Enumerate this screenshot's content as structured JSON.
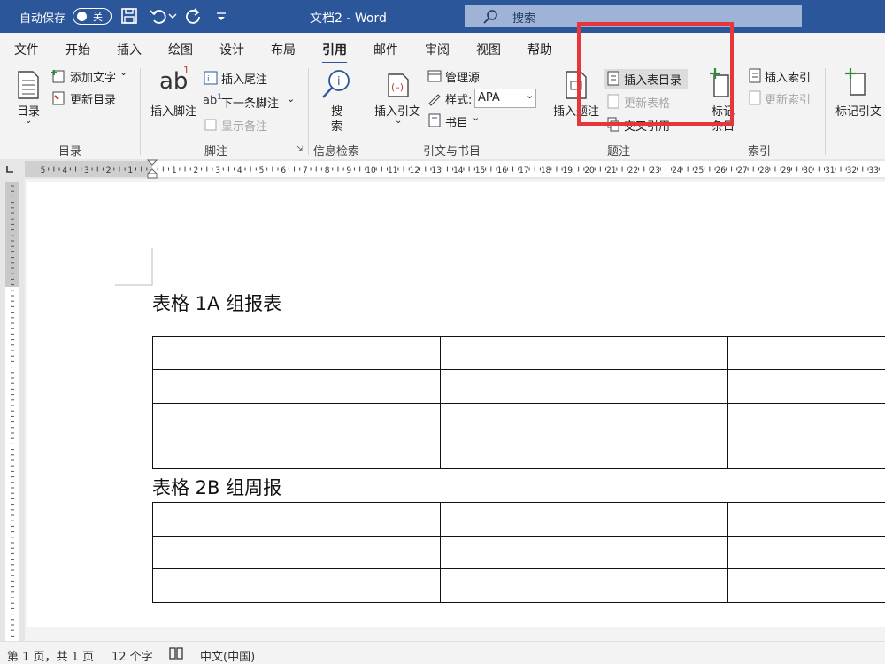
{
  "titlebar": {
    "autosave_label": "自动保存",
    "autosave_state": "关",
    "doc_title": "文档2  -  Word",
    "search_placeholder": "搜索"
  },
  "tabs": [
    {
      "label": "文件"
    },
    {
      "label": "开始"
    },
    {
      "label": "插入"
    },
    {
      "label": "绘图"
    },
    {
      "label": "设计"
    },
    {
      "label": "布局"
    },
    {
      "label": "引用",
      "active": true
    },
    {
      "label": "邮件"
    },
    {
      "label": "审阅"
    },
    {
      "label": "视图"
    },
    {
      "label": "帮助"
    }
  ],
  "ribbon": {
    "toc": {
      "button": "目录",
      "add_text": "添加文字",
      "update_toc": "更新目录",
      "group": "目录"
    },
    "footnotes": {
      "insert_footnote": "插入脚注",
      "insert_endnote": "插入尾注",
      "next_footnote": "下一条脚注",
      "show_notes": "显示备注",
      "group": "脚注"
    },
    "research": {
      "search_line1": "搜",
      "search_line2": "索",
      "group": "信息检索"
    },
    "citations": {
      "insert_citation": "插入引文",
      "manage_sources": "管理源",
      "style_label": "样式:",
      "style_value": "APA",
      "bibliography": "书目",
      "group": "引文与书目"
    },
    "captions": {
      "insert_caption": "插入题注",
      "insert_table_of_figures": "插入表目录",
      "update_table": "更新表格",
      "cross_reference": "交叉引用",
      "group": "题注"
    },
    "index": {
      "mark_entry_line1": "标记",
      "mark_entry_line2": "条目",
      "insert_index": "插入索引",
      "update_index": "更新索引",
      "group": "索引"
    },
    "authorities": {
      "mark_citation": "标记引文"
    }
  },
  "document": {
    "caption1": "表格  1A 组报表",
    "caption2": "表格  2B 组周报"
  },
  "status": {
    "page": "第 1 页，共 1 页",
    "words": "12 个字",
    "language": "中文(中国)"
  }
}
